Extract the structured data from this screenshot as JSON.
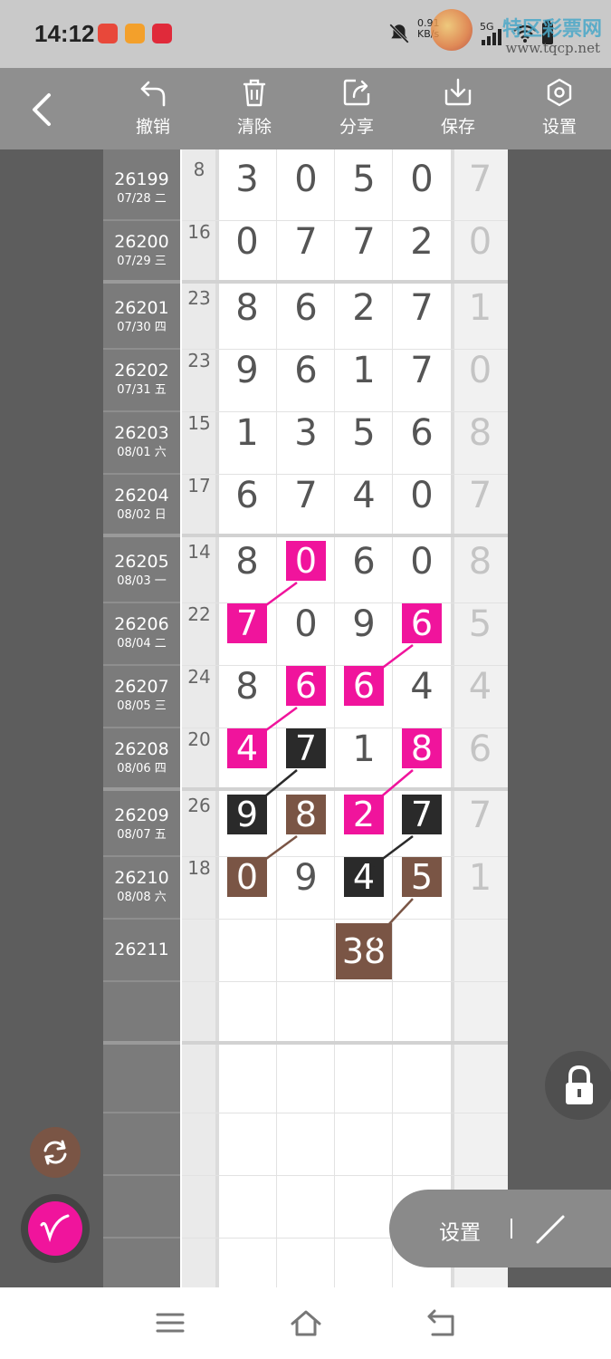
{
  "status_bar": {
    "time": "14:12",
    "net_speed_value": "0.91",
    "net_speed_unit": "KB/s",
    "network": "5G",
    "watermark": "特区彩票网",
    "watermark_url": "www.tqcp.net"
  },
  "toolbar": {
    "items": [
      {
        "label": "撤销",
        "icon": "undo-icon"
      },
      {
        "label": "清除",
        "icon": "trash-icon"
      },
      {
        "label": "分享",
        "icon": "share-icon"
      },
      {
        "label": "保存",
        "icon": "download-icon"
      },
      {
        "label": "设置",
        "icon": "settings-hex-icon"
      }
    ]
  },
  "grid": {
    "rows": [
      {
        "issue": "26199",
        "date": "07/28 二",
        "sum": "8",
        "digits": [
          "3",
          "0",
          "5",
          "0"
        ],
        "tail": "7"
      },
      {
        "issue": "26200",
        "date": "07/29 三",
        "sum": "16",
        "digits": [
          "0",
          "7",
          "7",
          "2"
        ],
        "tail": "0"
      },
      {
        "issue": "26201",
        "date": "07/30 四",
        "sum": "23",
        "digits": [
          "8",
          "6",
          "2",
          "7"
        ],
        "tail": "1"
      },
      {
        "issue": "26202",
        "date": "07/31 五",
        "sum": "23",
        "digits": [
          "9",
          "6",
          "1",
          "7"
        ],
        "tail": "0"
      },
      {
        "issue": "26203",
        "date": "08/01 六",
        "sum": "15",
        "digits": [
          "1",
          "3",
          "5",
          "6"
        ],
        "tail": "8"
      },
      {
        "issue": "26204",
        "date": "08/02 日",
        "sum": "17",
        "digits": [
          "6",
          "7",
          "4",
          "0"
        ],
        "tail": "7"
      },
      {
        "issue": "26205",
        "date": "08/03 一",
        "sum": "14",
        "digits": [
          "8",
          "0",
          "6",
          "0"
        ],
        "tail": "8"
      },
      {
        "issue": "26206",
        "date": "08/04 二",
        "sum": "22",
        "digits": [
          "7",
          "0",
          "9",
          "6"
        ],
        "tail": "5"
      },
      {
        "issue": "26207",
        "date": "08/05 三",
        "sum": "24",
        "digits": [
          "8",
          "6",
          "6",
          "4"
        ],
        "tail": "4"
      },
      {
        "issue": "26208",
        "date": "08/06 四",
        "sum": "20",
        "digits": [
          "4",
          "7",
          "1",
          "8"
        ],
        "tail": "6"
      },
      {
        "issue": "26209",
        "date": "08/07 五",
        "sum": "26",
        "digits": [
          "9",
          "8",
          "2",
          "7"
        ],
        "tail": "7"
      },
      {
        "issue": "26210",
        "date": "08/08 六",
        "sum": "18",
        "digits": [
          "0",
          "9",
          "4",
          "5"
        ],
        "tail": "1"
      },
      {
        "issue": "26211",
        "date": "",
        "sum": "",
        "digits": [
          "",
          "",
          "38",
          ""
        ],
        "tail": ""
      }
    ],
    "highlight_colors": {
      "pink": "#f0149c",
      "black": "#2a2a2a",
      "brown": "#7a5545"
    }
  },
  "floating": {
    "settings_label": "设置"
  }
}
